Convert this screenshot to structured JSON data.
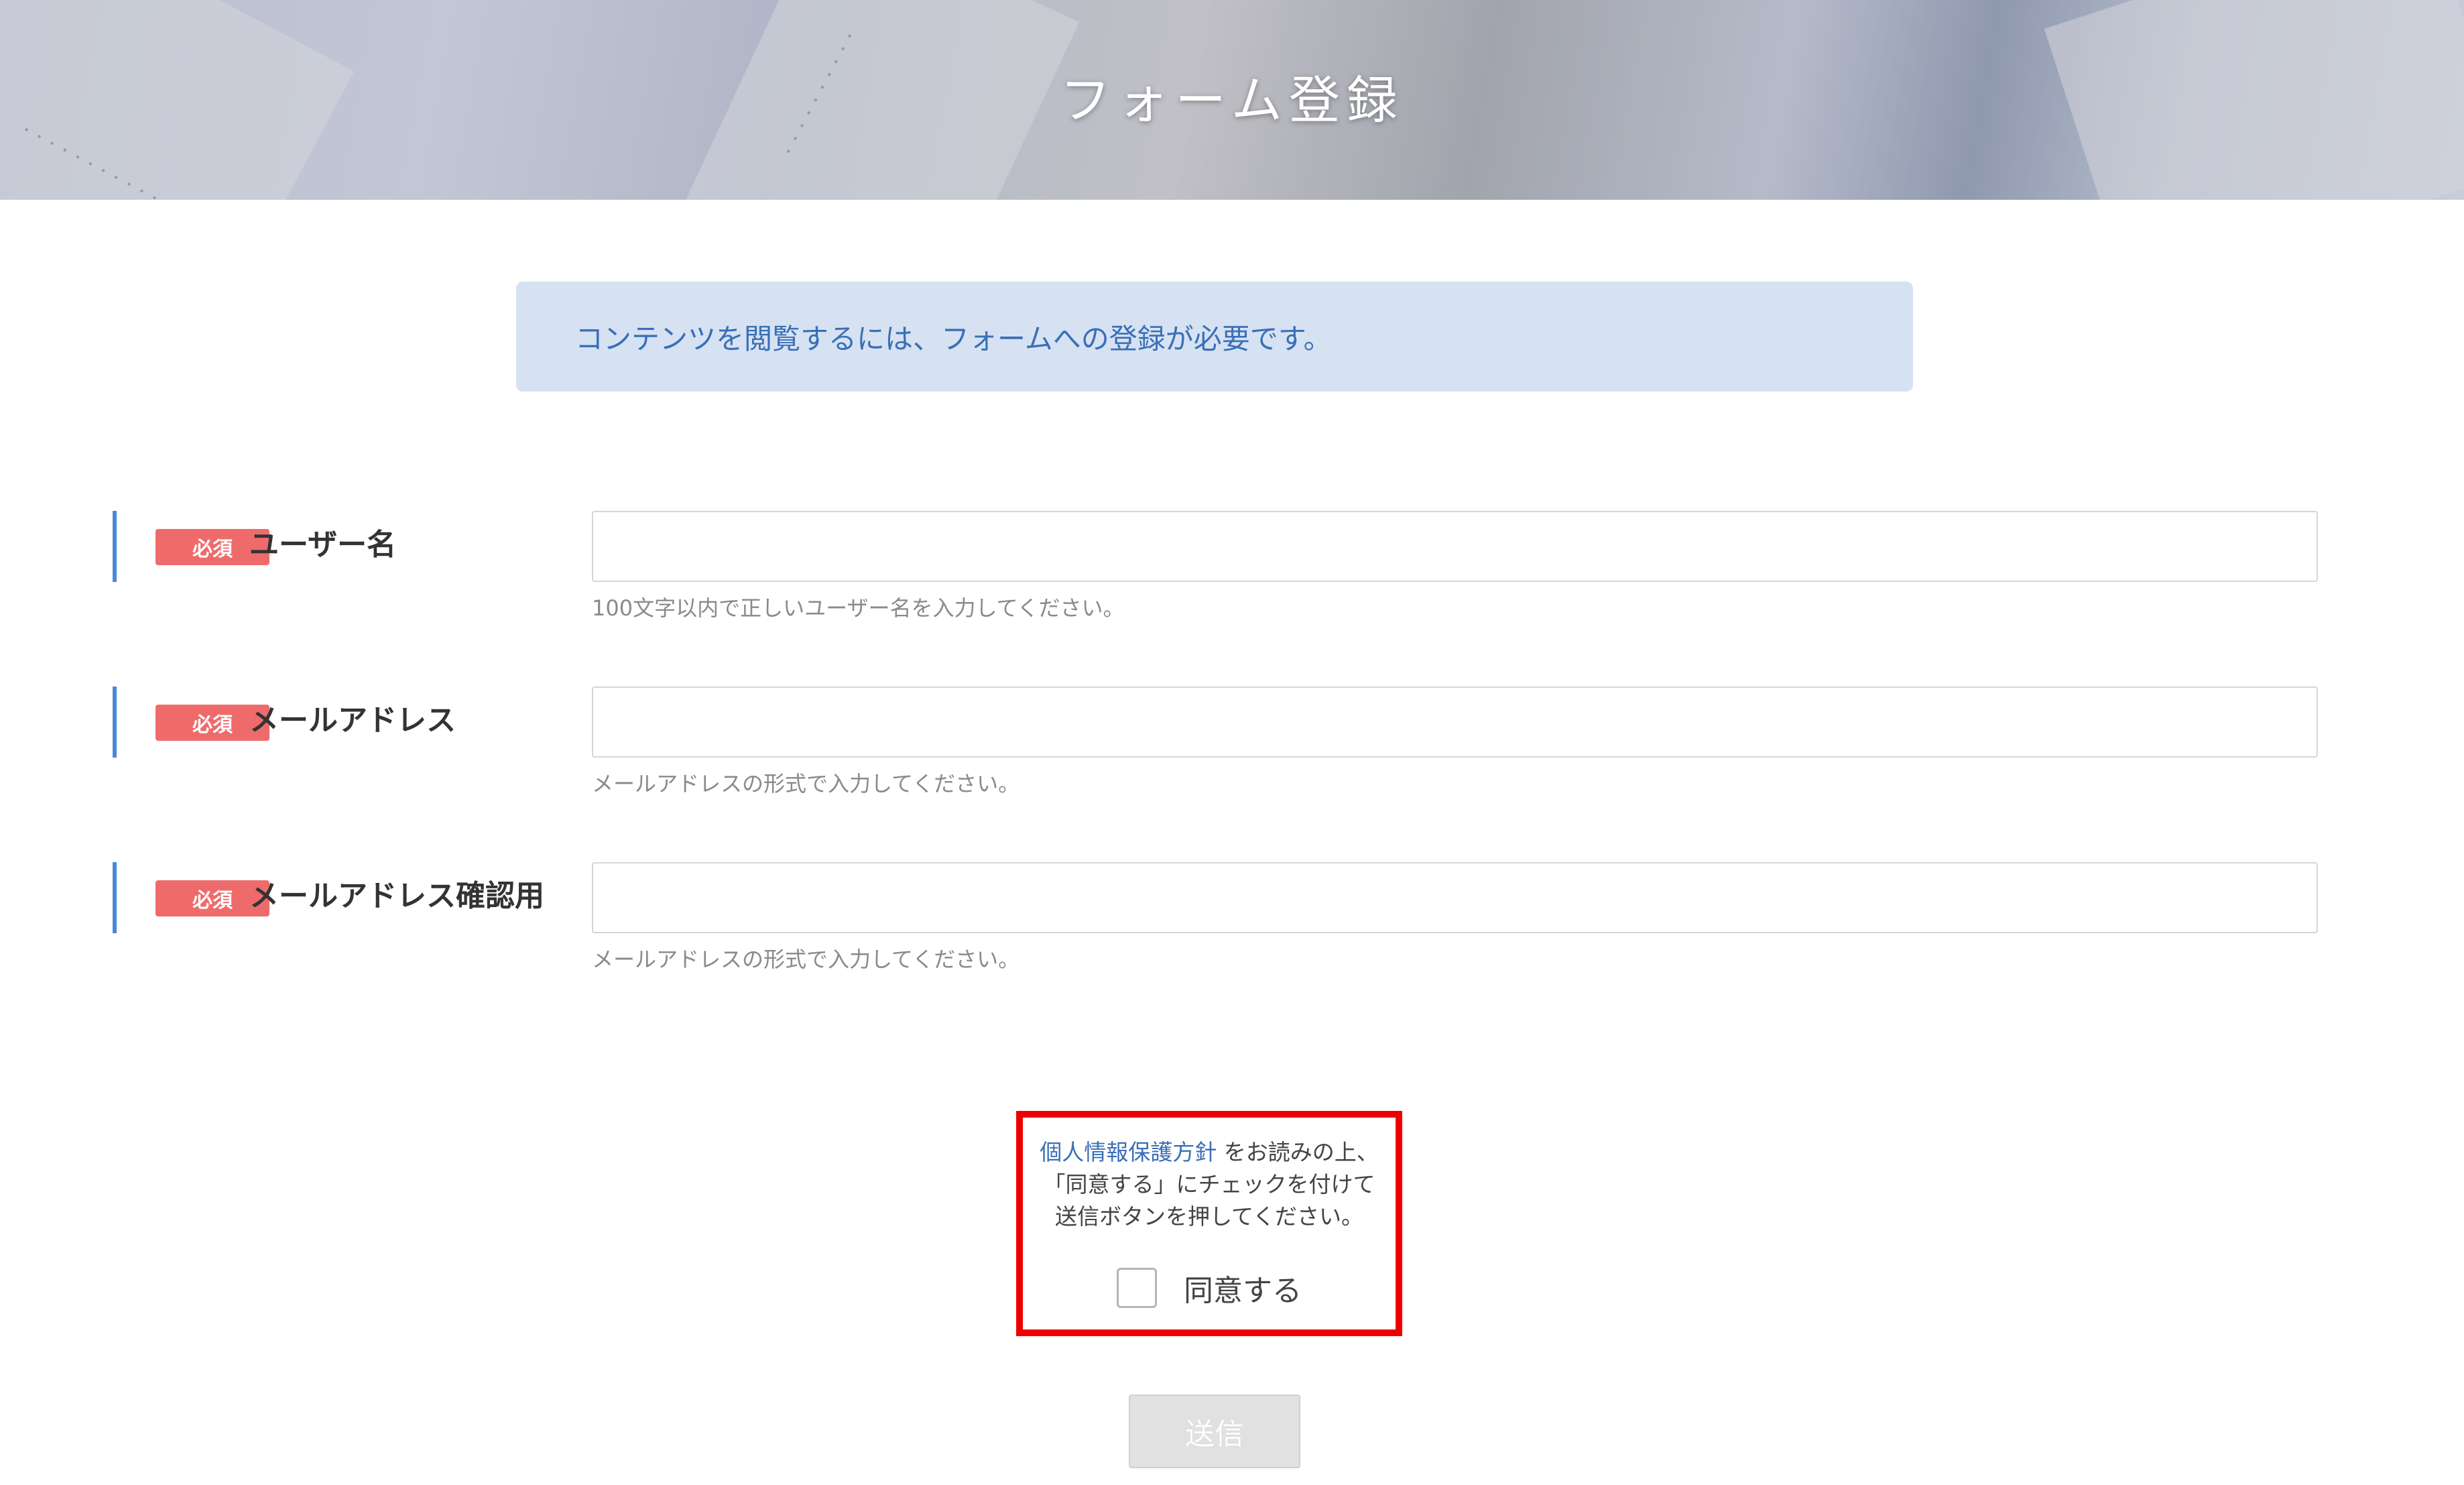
{
  "header": {
    "title": "フォーム登録"
  },
  "notice": {
    "text": "コンテンツを閲覧するには、フォームへの登録が必要です。"
  },
  "form": {
    "fields": [
      {
        "badge": "必須",
        "label": "ユーザー名",
        "value": "",
        "hint": "100文字以内で正しいユーザー名を入力してください。"
      },
      {
        "badge": "必須",
        "label": "メールアドレス",
        "value": "",
        "hint": "メールアドレスの形式で入力してください。"
      },
      {
        "badge": "必須",
        "label": "メールアドレス確認用",
        "value": "",
        "hint": "メールアドレスの形式で入力してください。"
      }
    ]
  },
  "consent": {
    "link_text": "個人情報保護方針",
    "line1_suffix": " をお読みの上、",
    "line2": "「同意する」にチェックを付けて",
    "line3": "送信ボタンを押してください。",
    "checkbox_label": "同意する",
    "checked": false
  },
  "submit": {
    "label": "送信"
  },
  "colors": {
    "accent": "#4a88d8",
    "badge": "#ef6b6b",
    "highlight": "#ee0000",
    "notice_bg": "#d6e2f2"
  }
}
